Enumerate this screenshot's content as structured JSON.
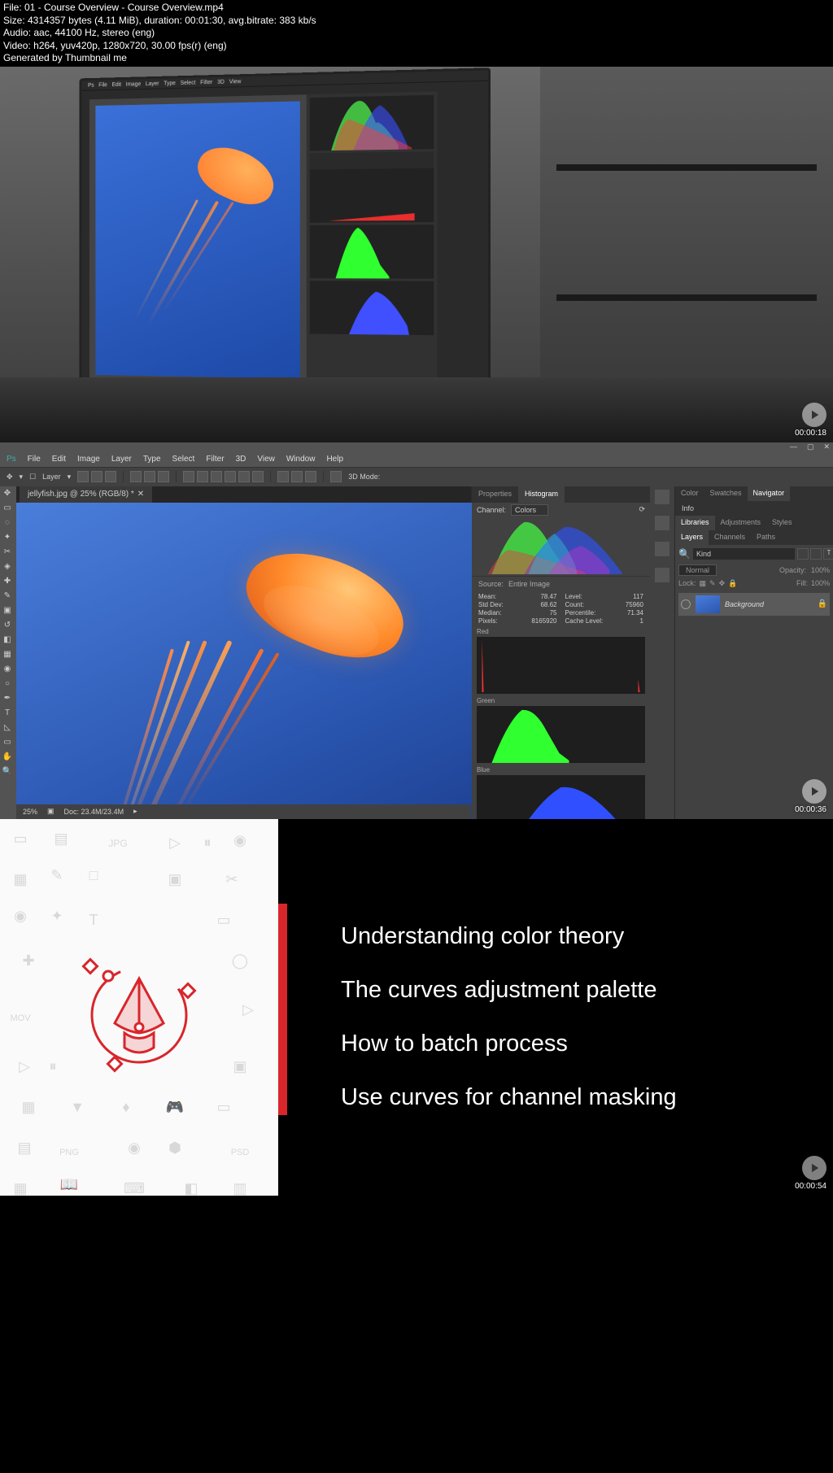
{
  "meta": {
    "line1": "File: 01 - Course Overview - Course Overview.mp4",
    "line2": "Size: 4314357 bytes (4.11 MiB), duration: 00:01:30, avg.bitrate: 383 kb/s",
    "line3": "Audio: aac, 44100 Hz, stereo (eng)",
    "line4": "Video: h264, yuv420p, 1280x720, 30.00 fps(r) (eng)",
    "line5": "Generated by Thumbnail me"
  },
  "frame1": {
    "timestamp": "00:00:18"
  },
  "frame2": {
    "timestamp": "00:00:36",
    "menu": [
      "File",
      "Edit",
      "Image",
      "Layer",
      "Type",
      "Select",
      "Filter",
      "3D",
      "View",
      "Window",
      "Help"
    ],
    "docTab": "jellyfish.jpg @ 25% (RGB/8) *",
    "zoom": "25%",
    "docSize": "Doc: 23.4M/23.4M",
    "panel1Tabs": {
      "a": "Properties",
      "b": "Histogram"
    },
    "channel": "Channel:",
    "channelVal": "Colors",
    "source": "Source:",
    "sourceVal": "Entire Image",
    "stats": {
      "mean": "78.47",
      "level": "117",
      "stddev": "68.62",
      "count": "75960",
      "median": "75",
      "percentile": "71.34",
      "pixels": "8165920",
      "cachelevel": "1"
    },
    "statLabels": {
      "mean": "Mean:",
      "level": "Level:",
      "stddev": "Std Dev:",
      "count": "Count:",
      "median": "Median:",
      "percentile": "Percentile:",
      "pixels": "Pixels:",
      "cachelevel": "Cache Level:"
    },
    "histLabels": {
      "red": "Red",
      "green": "Green",
      "blue": "Blue"
    },
    "p2top": {
      "a": "Color",
      "b": "Swatches",
      "c": "Navigator"
    },
    "info": "Info",
    "p2mid": {
      "a": "Libraries",
      "b": "Adjustments",
      "c": "Styles"
    },
    "p2layers": {
      "a": "Layers",
      "b": "Channels",
      "c": "Paths"
    },
    "layerSearch": "Kind",
    "blendMode": "Normal",
    "opacity": "Opacity:",
    "opacityVal": "100%",
    "lock": "Lock:",
    "fill": "Fill:",
    "fillVal": "100%",
    "bgLayer": "Background",
    "ribbon": {
      "layer": "Layer",
      "mode3d": "3D Mode:"
    }
  },
  "frame3": {
    "timestamp": "00:00:54",
    "items": [
      "Understanding color theory",
      "The curves adjustment palette",
      "How to batch process",
      "Use curves for channel masking"
    ]
  }
}
